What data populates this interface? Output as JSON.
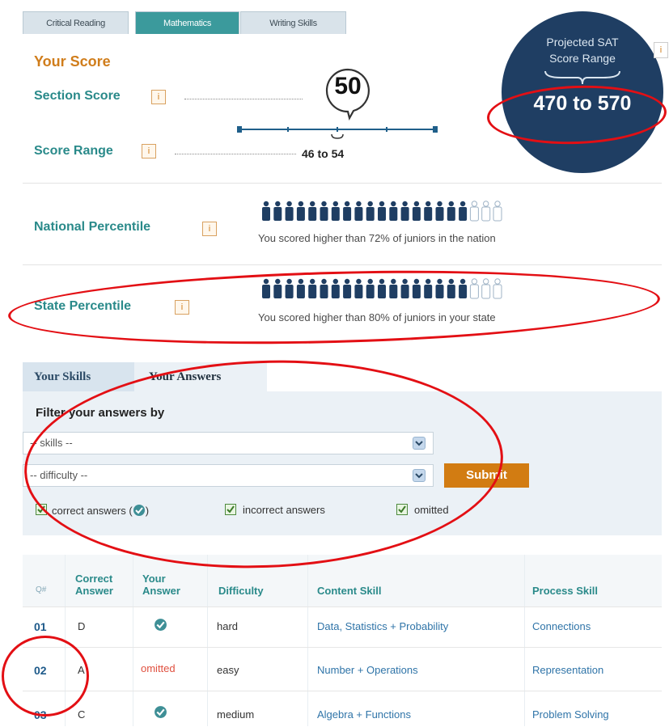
{
  "tabs": [
    "Critical Reading",
    "Mathematics",
    "Writing Skills"
  ],
  "active_tab": "Mathematics",
  "score": {
    "heading": "Your Score",
    "section_score_label": "Section Score",
    "section_score_value": "50",
    "score_range_label": "Score Range",
    "score_range_value": "46 to 54",
    "info_glyph": "i"
  },
  "projected": {
    "title_line1": "Projected SAT",
    "title_line2": "Score Range",
    "range": "470 to 570",
    "info_glyph": "i"
  },
  "national": {
    "label": "National Percentile",
    "text": "You scored higher than 72% of juniors in the nation",
    "filled_icons": 18,
    "total_icons": 21
  },
  "state": {
    "label": "State Percentile",
    "text": "You scored higher than 80% of juniors in your state",
    "filled_icons": 18,
    "total_icons": 21
  },
  "sub_tabs": [
    "Your Skills",
    "Your Answers"
  ],
  "filter": {
    "title": "Filter your answers by",
    "skills_value": "-- skills --",
    "difficulty_value": "-- difficulty --",
    "submit_label": "Submit",
    "checkbox_correct": "correct answers (",
    "checkbox_correct_end": ")",
    "checkbox_incorrect": "incorrect answers",
    "checkbox_omitted": "omitted"
  },
  "table": {
    "headers": {
      "q": "Q#",
      "correct_1": "Correct",
      "correct_2": "Answer",
      "your_1": "Your",
      "your_2": "Answer",
      "difficulty": "Difficulty",
      "content": "Content Skill",
      "process": "Process Skill"
    },
    "rows": [
      {
        "q": "01",
        "correct": "D",
        "your": "check-icon",
        "difficulty": "hard",
        "content": "Data, Statistics + Probability",
        "process": "Connections"
      },
      {
        "q": "02",
        "correct": "A",
        "your": "omitted",
        "difficulty": "easy",
        "content": "Number + Operations",
        "process": "Representation"
      },
      {
        "q": "03",
        "correct": "C",
        "your": "check-icon",
        "difficulty": "medium",
        "content": "Algebra + Functions",
        "process": "Problem Solving"
      }
    ]
  },
  "colors": {
    "teal": "#3b9a9c",
    "orange": "#d07d1b",
    "navy": "#1f3e63",
    "annotation_red": "#e30f14",
    "icon_navy": "#1f3e63",
    "icon_empty": "#9fb3c6"
  }
}
